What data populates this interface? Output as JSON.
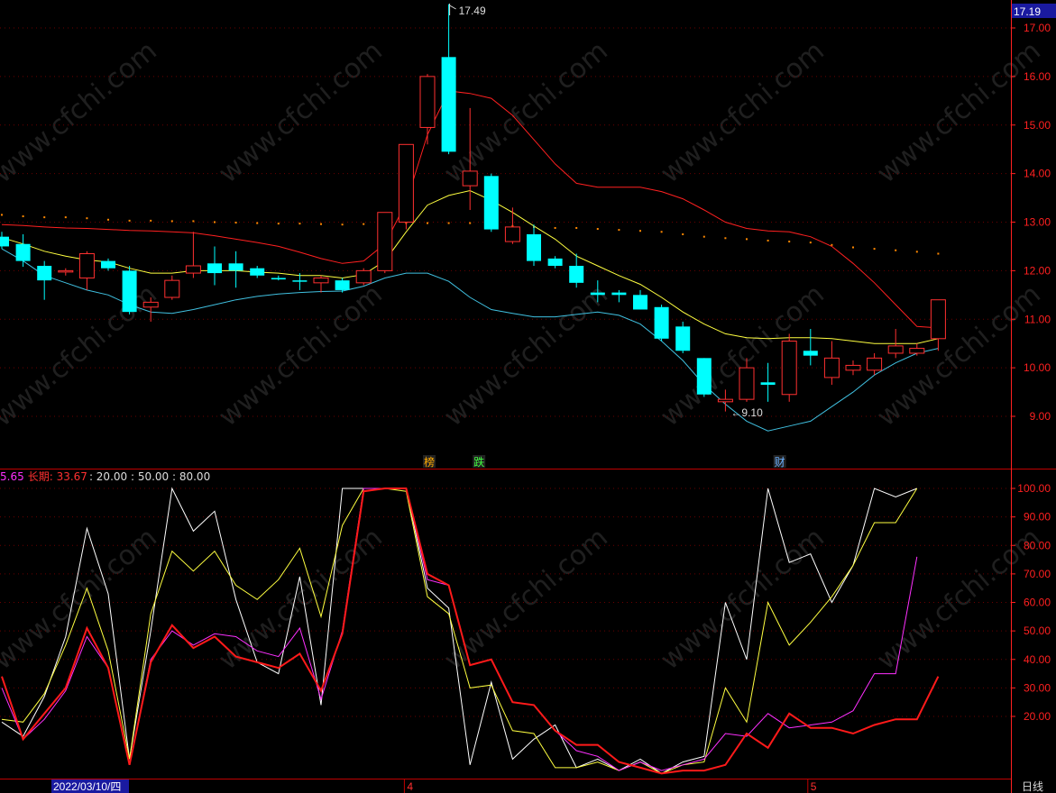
{
  "watermark": "www.cfchi.com",
  "colors": {
    "background": "#000000",
    "up": "#ff3030",
    "down": "#00ffff",
    "ma_yellow": "#ffff40",
    "band_upper": "#ff2020",
    "band_lower": "#40c0e0",
    "dots": "#ff8800",
    "grid": "#6a0000",
    "axis": "#ff2020",
    "osc_white": "#ffffff",
    "osc_yellow": "#ffff40",
    "osc_magenta": "#ff30ff",
    "osc_red": "#ff1a1a"
  },
  "price_badge": "17.19",
  "high_marker": "17.49",
  "low_marker": "9.10",
  "event_tags": [
    {
      "text": "榜",
      "color": "#ffaa00"
    },
    {
      "text": "跌",
      "color": "#40ff40"
    },
    {
      "text": "财",
      "color": "#6ab0ff"
    }
  ],
  "osc_legend": {
    "lead": "5.65",
    "label": "长期: 33.67",
    "levels": ": 20.00 : 50.00 : 80.00"
  },
  "date_label": "2022/03/10/四",
  "month_labels": [
    "4",
    "5"
  ],
  "period_label": "日线",
  "chart_data": [
    {
      "type": "candlestick",
      "ylim": [
        8.3,
        17.5
      ],
      "y_ticks": [
        9.0,
        10.0,
        11.0,
        12.0,
        13.0,
        14.0,
        15.0,
        16.0,
        17.0
      ],
      "tick_labels": [
        "9.00",
        "10.00",
        "11.00",
        "12.00",
        "13.00",
        "14.00",
        "15.00",
        "16.00",
        "17.00"
      ],
      "candles": [
        {
          "o": 12.7,
          "h": 12.8,
          "l": 12.45,
          "c": 12.5
        },
        {
          "o": 12.55,
          "h": 12.75,
          "l": 12.08,
          "c": 12.2
        },
        {
          "o": 12.1,
          "h": 12.2,
          "l": 11.4,
          "c": 11.8
        },
        {
          "o": 12.0,
          "h": 12.05,
          "l": 11.9,
          "c": 12.0
        },
        {
          "o": 11.85,
          "h": 12.4,
          "l": 11.6,
          "c": 12.35
        },
        {
          "o": 12.2,
          "h": 12.25,
          "l": 12.0,
          "c": 12.05
        },
        {
          "o": 12.0,
          "h": 12.1,
          "l": 11.1,
          "c": 11.15
        },
        {
          "o": 11.25,
          "h": 11.45,
          "l": 10.95,
          "c": 11.35
        },
        {
          "o": 11.45,
          "h": 11.9,
          "l": 11.4,
          "c": 11.8
        },
        {
          "o": 11.95,
          "h": 12.8,
          "l": 11.85,
          "c": 12.1
        },
        {
          "o": 12.15,
          "h": 12.5,
          "l": 11.7,
          "c": 11.95
        },
        {
          "o": 12.15,
          "h": 12.4,
          "l": 11.65,
          "c": 12.0
        },
        {
          "o": 12.05,
          "h": 12.1,
          "l": 11.85,
          "c": 11.9
        },
        {
          "o": 11.85,
          "h": 11.9,
          "l": 11.8,
          "c": 11.82
        },
        {
          "o": 11.8,
          "h": 11.95,
          "l": 11.6,
          "c": 11.78
        },
        {
          "o": 11.75,
          "h": 11.9,
          "l": 11.55,
          "c": 11.85
        },
        {
          "o": 11.8,
          "h": 11.85,
          "l": 11.55,
          "c": 11.6
        },
        {
          "o": 11.75,
          "h": 12.05,
          "l": 11.7,
          "c": 12.0
        },
        {
          "o": 12.0,
          "h": 12.5,
          "l": 11.95,
          "c": 13.2
        },
        {
          "o": 13.0,
          "h": 14.6,
          "l": 12.85,
          "c": 14.6
        },
        {
          "o": 14.95,
          "h": 16.05,
          "l": 14.6,
          "c": 16.0
        },
        {
          "o": 16.4,
          "h": 17.49,
          "l": 14.4,
          "c": 14.45
        },
        {
          "o": 13.75,
          "h": 15.35,
          "l": 13.25,
          "c": 14.05
        },
        {
          "o": 13.95,
          "h": 14.0,
          "l": 12.8,
          "c": 12.85
        },
        {
          "o": 12.6,
          "h": 13.3,
          "l": 12.55,
          "c": 12.9
        },
        {
          "o": 12.75,
          "h": 12.95,
          "l": 12.1,
          "c": 12.2
        },
        {
          "o": 12.25,
          "h": 12.3,
          "l": 12.05,
          "c": 12.1
        },
        {
          "o": 12.1,
          "h": 12.35,
          "l": 11.65,
          "c": 11.75
        },
        {
          "o": 11.55,
          "h": 11.8,
          "l": 11.35,
          "c": 11.5
        },
        {
          "o": 11.55,
          "h": 11.6,
          "l": 11.35,
          "c": 11.5
        },
        {
          "o": 11.5,
          "h": 11.6,
          "l": 11.2,
          "c": 11.2
        },
        {
          "o": 11.25,
          "h": 11.3,
          "l": 10.55,
          "c": 10.6
        },
        {
          "o": 10.85,
          "h": 10.95,
          "l": 10.3,
          "c": 10.35
        },
        {
          "o": 10.2,
          "h": 10.2,
          "l": 9.4,
          "c": 9.45
        },
        {
          "o": 9.3,
          "h": 9.55,
          "l": 9.1,
          "c": 9.35
        },
        {
          "o": 9.35,
          "h": 10.2,
          "l": 9.3,
          "c": 10.0
        },
        {
          "o": 9.7,
          "h": 10.1,
          "l": 9.3,
          "c": 9.65
        },
        {
          "o": 9.45,
          "h": 10.7,
          "l": 9.3,
          "c": 10.55
        },
        {
          "o": 10.35,
          "h": 10.8,
          "l": 10.05,
          "c": 10.25
        },
        {
          "o": 9.8,
          "h": 10.55,
          "l": 9.65,
          "c": 10.2
        },
        {
          "o": 9.95,
          "h": 10.15,
          "l": 9.85,
          "c": 10.05
        },
        {
          "o": 9.95,
          "h": 10.3,
          "l": 9.85,
          "c": 10.2
        },
        {
          "o": 10.3,
          "h": 10.8,
          "l": 10.2,
          "c": 10.45
        },
        {
          "o": 10.3,
          "h": 10.5,
          "l": 10.25,
          "c": 10.4
        },
        {
          "o": 10.6,
          "h": 11.4,
          "l": 10.35,
          "c": 11.4
        }
      ],
      "series": [
        {
          "key": "upper",
          "values": [
            12.95,
            12.93,
            12.9,
            12.88,
            12.87,
            12.85,
            12.83,
            12.82,
            12.8,
            12.78,
            12.72,
            12.65,
            12.58,
            12.5,
            12.38,
            12.25,
            12.15,
            12.2,
            12.55,
            13.4,
            14.8,
            15.7,
            15.65,
            15.55,
            15.2,
            14.7,
            14.2,
            13.8,
            13.72,
            13.72,
            13.72,
            13.63,
            13.48,
            13.25,
            13.0,
            12.87,
            12.82,
            12.8,
            12.7,
            12.5,
            12.15,
            11.75,
            11.3,
            10.85,
            10.82
          ]
        },
        {
          "key": "ma",
          "values": [
            12.68,
            12.55,
            12.4,
            12.3,
            12.22,
            12.18,
            12.05,
            11.95,
            11.95,
            12.0,
            12.0,
            12.0,
            11.97,
            11.95,
            11.9,
            11.9,
            11.85,
            11.92,
            12.2,
            12.8,
            13.35,
            13.55,
            13.65,
            13.45,
            13.2,
            12.92,
            12.65,
            12.3,
            12.1,
            11.9,
            11.72,
            11.45,
            11.15,
            10.9,
            10.7,
            10.62,
            10.6,
            10.62,
            10.62,
            10.6,
            10.55,
            10.5,
            10.5,
            10.5,
            10.6
          ]
        },
        {
          "key": "lower",
          "values": [
            12.45,
            12.2,
            11.9,
            11.75,
            11.6,
            11.5,
            11.3,
            11.15,
            11.12,
            11.2,
            11.3,
            11.4,
            11.47,
            11.52,
            11.55,
            11.57,
            11.58,
            11.68,
            11.85,
            11.95,
            11.95,
            11.78,
            11.45,
            11.2,
            11.12,
            11.05,
            11.05,
            11.1,
            11.15,
            11.08,
            10.9,
            10.55,
            10.15,
            9.65,
            9.25,
            8.9,
            8.7,
            8.8,
            8.9,
            9.2,
            9.5,
            9.85,
            10.1,
            10.3,
            10.4
          ]
        },
        {
          "key": "dots",
          "values": [
            13.15,
            13.12,
            13.1,
            13.1,
            13.08,
            13.05,
            13.03,
            13.03,
            13.02,
            13.02,
            13.0,
            12.99,
            12.98,
            12.97,
            12.97,
            12.96,
            12.95,
            12.96,
            12.97,
            12.98,
            12.98,
            12.98,
            12.98,
            12.95,
            12.92,
            12.9,
            12.88,
            12.88,
            12.86,
            12.84,
            12.82,
            12.8,
            12.75,
            12.7,
            12.67,
            12.65,
            12.62,
            12.6,
            12.58,
            12.53,
            12.48,
            12.45,
            12.42,
            12.39,
            12.35
          ]
        }
      ]
    },
    {
      "type": "line",
      "ylim": [
        0,
        105
      ],
      "y_ticks": [
        20,
        30,
        40,
        50,
        60,
        70,
        80,
        90,
        100
      ],
      "tick_labels": [
        "20.00",
        "30.00",
        "40.00",
        "50.00",
        "60.00",
        "70.00",
        "80.00",
        "90.00",
        "100.00"
      ],
      "levels": [
        20,
        50,
        80
      ],
      "series": [
        {
          "key": "white",
          "values": [
            18,
            13,
            27,
            48,
            86,
            63,
            5,
            50,
            100,
            85,
            92,
            61,
            39,
            35,
            69,
            24,
            100,
            100,
            100,
            100,
            65,
            58,
            3,
            32,
            5,
            12,
            17,
            2,
            5,
            1,
            5,
            0,
            4,
            6,
            60,
            40,
            100,
            74,
            77,
            60,
            73,
            100,
            97,
            100
          ]
        },
        {
          "key": "yellow",
          "values": [
            19,
            18,
            28,
            45,
            65,
            43,
            5,
            56,
            78,
            71,
            78,
            66,
            61,
            68,
            79,
            55,
            87,
            100,
            100,
            99,
            62,
            56,
            30,
            31,
            15,
            14,
            2,
            2,
            4,
            1,
            4,
            0,
            3,
            4,
            30,
            18,
            60,
            45,
            53,
            62,
            73,
            88,
            88,
            100
          ]
        },
        {
          "key": "magenta",
          "values": [
            30,
            12,
            19,
            29,
            48,
            37,
            3,
            40,
            50,
            45,
            49,
            48,
            43,
            41,
            51,
            26,
            50,
            100,
            100,
            100,
            68,
            66,
            38,
            40,
            25,
            24,
            15,
            8,
            6,
            1,
            4,
            1,
            3,
            5,
            14,
            13,
            21,
            16,
            17,
            18,
            22,
            35,
            35,
            76
          ]
        },
        {
          "key": "red",
          "values": [
            34,
            12,
            21,
            30,
            51,
            37,
            3,
            39,
            52,
            44,
            48,
            41,
            39,
            37,
            42,
            29,
            49,
            99,
            100,
            100,
            70,
            66,
            38,
            40,
            25,
            24,
            15,
            10,
            10,
            4,
            2,
            0,
            1,
            1,
            3,
            14,
            9,
            21,
            16,
            16,
            14,
            17,
            19,
            19,
            34
          ]
        }
      ]
    }
  ]
}
